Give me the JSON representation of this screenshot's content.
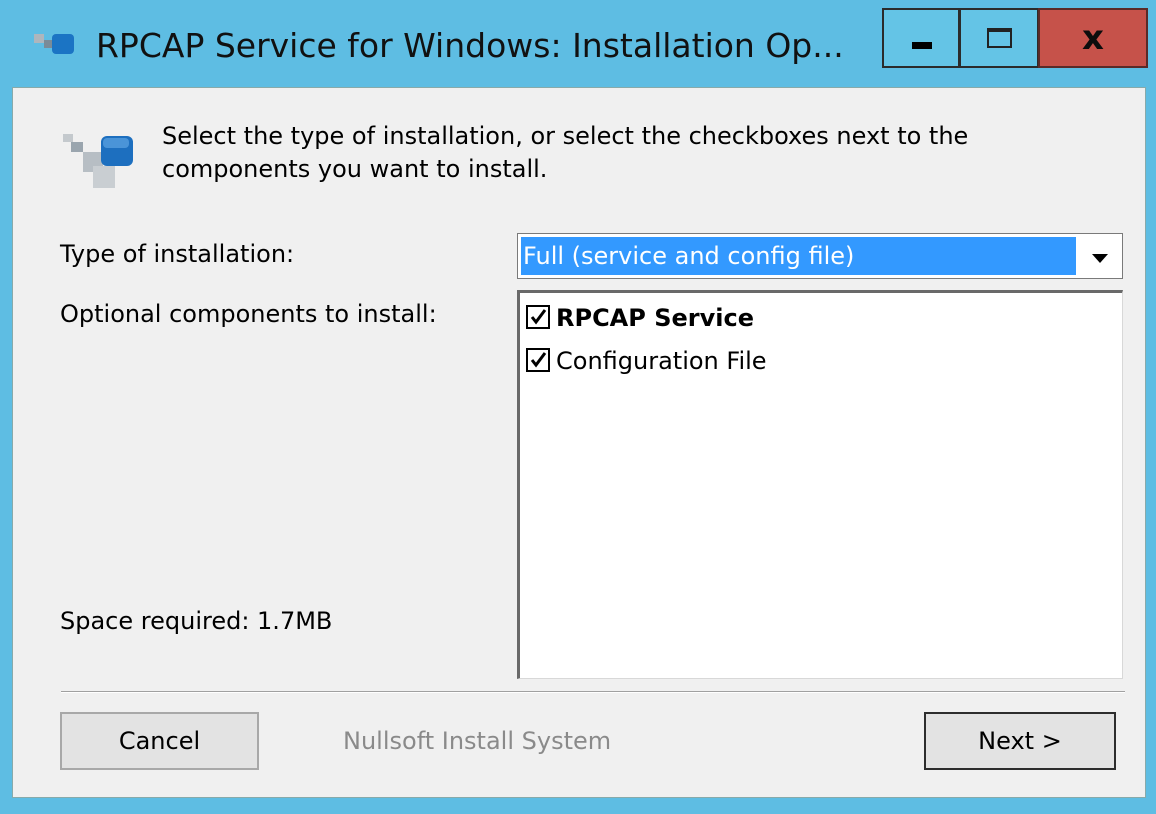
{
  "window": {
    "title": "RPCAP Service for Windows: Installation Op...",
    "close_glyph": "x",
    "controls": [
      "minimize-icon",
      "maximize-icon",
      "close-icon"
    ]
  },
  "header": {
    "instructions": "Select the type of installation, or select the checkboxes next to the components you want to install."
  },
  "form": {
    "type_label": "Type of installation:",
    "type_selected": "Full (service and config file)",
    "optional_label": "Optional components to install:",
    "components": [
      {
        "label": "RPCAP Service",
        "checked": true
      },
      {
        "label": "Configuration File",
        "checked": true
      }
    ],
    "space_required": "Space required: 1.7MB"
  },
  "footer": {
    "cancel_label": "Cancel",
    "branding": "Nullsoft Install System",
    "next_label": "Next >"
  },
  "colors": {
    "titlebar": "#5ebde3",
    "close_button": "#c6524a",
    "selection": "#3399ff",
    "dialog_bg": "#f0f0f0"
  }
}
